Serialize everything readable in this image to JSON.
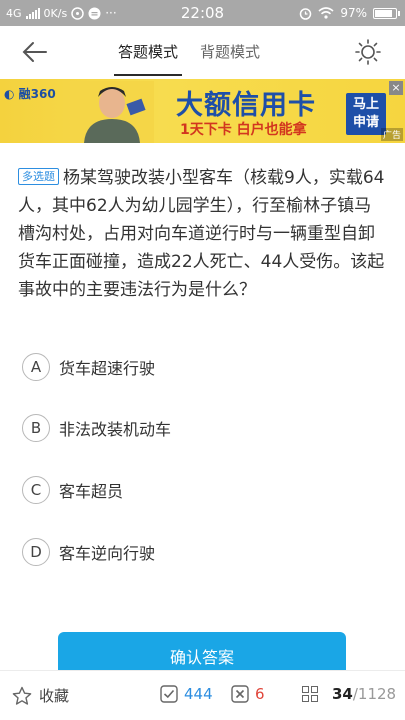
{
  "status_bar": {
    "network": "4G",
    "speed": "0K/s",
    "time": "22:08",
    "battery": "97%",
    "battery_level": 0.97
  },
  "header": {
    "tabs": [
      {
        "label": "答题模式",
        "active": true
      },
      {
        "label": "背题模式",
        "active": false
      }
    ],
    "icons": {
      "back": "arrow-left-icon",
      "theme": "sun-icon"
    }
  },
  "ad": {
    "logo": "融360",
    "title": "大额信用卡",
    "subtitle": "1天下卡 白户也能拿",
    "cta_line1": "马上",
    "cta_line2": "申请",
    "close": "×",
    "tag": "广告",
    "colors": {
      "background": "#f6d53f",
      "title": "#1e4fa8",
      "subtitle": "#d2361f"
    }
  },
  "question": {
    "badge": "多选题",
    "text": "杨某驾驶改装小型客车（核载9人，实载64人，其中62人为幼儿园学生），行至榆林子镇马槽沟村处，占用对向车道逆行时与一辆重型自卸货车正面碰撞，造成22人死亡、44人受伤。该起事故中的主要违法行为是什么？"
  },
  "options": [
    {
      "letter": "A",
      "text": "货车超速行驶"
    },
    {
      "letter": "B",
      "text": "非法改装机动车"
    },
    {
      "letter": "C",
      "text": "客车超员"
    },
    {
      "letter": "D",
      "text": "客车逆向行驶"
    }
  ],
  "confirm_button": {
    "label": "确认答案",
    "color": "#1aa6e6"
  },
  "bottom_bar": {
    "favorite_label": "收藏",
    "correct_count": "444",
    "wrong_count": "6",
    "current": "34",
    "total": "/1128",
    "colors": {
      "correct": "#2d8ee0",
      "wrong": "#e0453a"
    }
  }
}
